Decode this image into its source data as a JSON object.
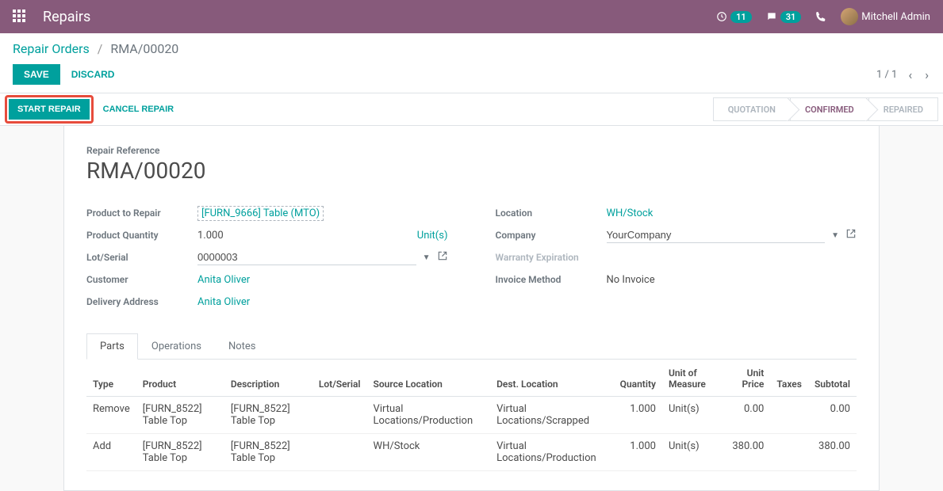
{
  "topbar": {
    "title": "Repairs",
    "clock_badge": "11",
    "chat_badge": "31",
    "user_name": "Mitchell Admin"
  },
  "breadcrumb": {
    "parent": "Repair Orders",
    "current": "RMA/00020"
  },
  "buttons": {
    "save": "SAVE",
    "discard": "DISCARD",
    "start_repair": "START REPAIR",
    "cancel_repair": "CANCEL REPAIR"
  },
  "pager": {
    "position": "1 / 1"
  },
  "status": {
    "quotation": "QUOTATION",
    "confirmed": "CONFIRMED",
    "repaired": "REPAIRED"
  },
  "sheet": {
    "ref_label": "Repair Reference",
    "ref_value": "RMA/00020",
    "left": {
      "product_to_repair_label": "Product to Repair",
      "product_to_repair_value": "[FURN_9666] Table (MTO)",
      "product_quantity_label": "Product Quantity",
      "product_quantity_value": "1.000",
      "product_quantity_uom": "Unit(s)",
      "lot_serial_label": "Lot/Serial",
      "lot_serial_value": "0000003",
      "customer_label": "Customer",
      "customer_value": "Anita Oliver",
      "delivery_address_label": "Delivery Address",
      "delivery_address_value": "Anita Oliver"
    },
    "right": {
      "location_label": "Location",
      "location_value": "WH/Stock",
      "company_label": "Company",
      "company_value": "YourCompany",
      "warranty_label": "Warranty Expiration",
      "invoice_method_label": "Invoice Method",
      "invoice_method_value": "No Invoice"
    }
  },
  "tabs": {
    "parts": "Parts",
    "operations": "Operations",
    "notes": "Notes"
  },
  "parts_table": {
    "headers": {
      "type": "Type",
      "product": "Product",
      "description": "Description",
      "lot_serial": "Lot/Serial",
      "source_location": "Source Location",
      "dest_location": "Dest. Location",
      "quantity": "Quantity",
      "uom": "Unit of Measure",
      "unit_price": "Unit Price",
      "taxes": "Taxes",
      "subtotal": "Subtotal"
    },
    "rows": [
      {
        "type": "Remove",
        "product": "[FURN_8522] Table Top",
        "description": "[FURN_8522] Table Top",
        "lot_serial": "",
        "source_location": "Virtual Locations/Production",
        "dest_location": "Virtual Locations/Scrapped",
        "quantity": "1.000",
        "uom": "Unit(s)",
        "unit_price": "0.00",
        "taxes": "",
        "subtotal": "0.00"
      },
      {
        "type": "Add",
        "product": "[FURN_8522] Table Top",
        "description": "[FURN_8522] Table Top",
        "lot_serial": "",
        "source_location": "WH/Stock",
        "dest_location": "Virtual Locations/Production",
        "quantity": "1.000",
        "uom": "Unit(s)",
        "unit_price": "380.00",
        "taxes": "",
        "subtotal": "380.00"
      }
    ]
  }
}
